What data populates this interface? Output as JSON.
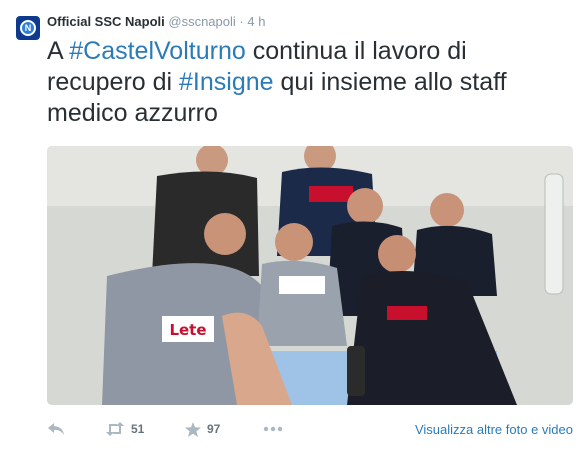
{
  "tweet": {
    "author_name": "Official SSC Napoli",
    "handle": "@sscnapoli",
    "separator": "·",
    "time": "4 h",
    "text_parts": {
      "p1": "A ",
      "tag1": "#CastelVolturno",
      "p2": " continua il lavoro di recupero di ",
      "tag2": "#Insigne",
      "p3": " qui insieme allo staff medico azzurro"
    },
    "photo_sponsor": "Lete",
    "retweet_count": "51",
    "favorite_count": "97",
    "more_photos_link": "Visualizza altre foto e video",
    "link_color": "#2b7bb9",
    "icons": [
      "napoli-logo-icon",
      "reply-icon",
      "retweet-icon",
      "favorite-star-icon",
      "more-dots-icon"
    ]
  }
}
